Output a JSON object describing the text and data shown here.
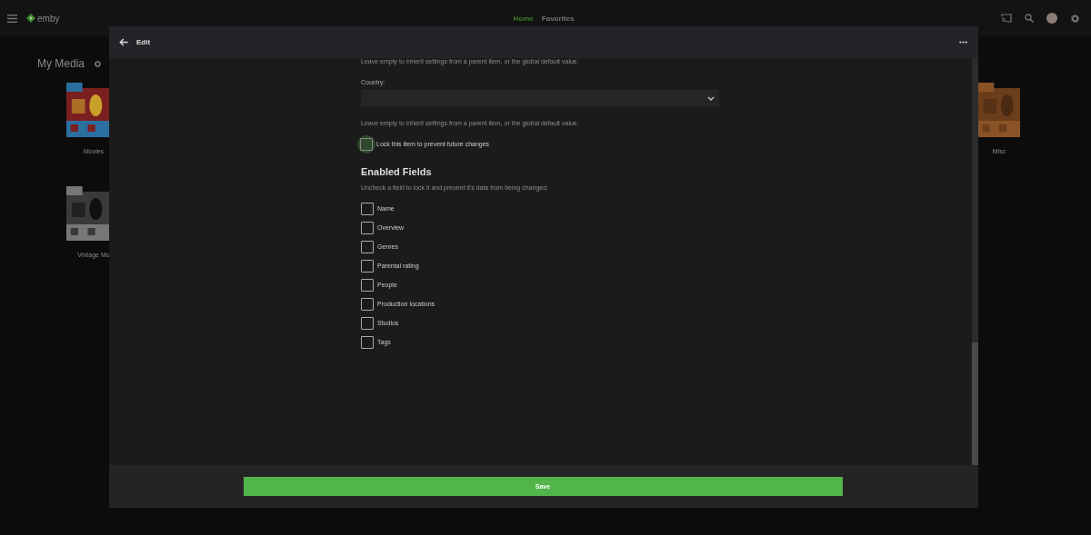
{
  "app_bar": {
    "logo": "emby",
    "tabs": [
      {
        "label": "Home",
        "selected": true
      },
      {
        "label": "Favorites",
        "selected": false
      }
    ]
  },
  "library": {
    "title": "My Media",
    "tile_rows": [
      {
        "tiles": [
          {
            "label": "Movies",
            "kind": "picture"
          },
          {
            "label": "Misc",
            "kind": "picture"
          }
        ]
      },
      {
        "tiles": [
          {
            "label": "Vintage Mo",
            "kind": "picture"
          }
        ]
      }
    ]
  },
  "dialog": {
    "title": "Edit",
    "content": [
      {
        "kind": "hint",
        "text": "Leave empty to inherit settings from a parent item, or the global default value."
      },
      {
        "kind": "select",
        "label": "Country:"
      },
      {
        "kind": "hint",
        "text": "Leave empty to inherit settings from a parent item, or the global default value."
      },
      {
        "kind": "checkbox",
        "label": "Lock this item to prevent future changes",
        "checked": false,
        "focused": true
      },
      {
        "kind": "heading",
        "text": "Enabled Fields"
      },
      {
        "kind": "hint",
        "text": "Uncheck a field to lock it and prevent it's data from being changed."
      },
      {
        "kind": "checkbox",
        "label": "Name",
        "checked": false,
        "focused": false
      },
      {
        "kind": "checkbox",
        "label": "Overview",
        "checked": false,
        "focused": false
      },
      {
        "kind": "checkbox",
        "label": "Genres",
        "checked": false,
        "focused": false
      },
      {
        "kind": "checkbox",
        "label": "Parental rating",
        "checked": false,
        "focused": false
      },
      {
        "kind": "checkbox",
        "label": "People",
        "checked": false,
        "focused": false
      },
      {
        "kind": "checkbox",
        "label": "Production locations",
        "checked": false,
        "focused": false
      },
      {
        "kind": "checkbox",
        "label": "Studios",
        "checked": false,
        "focused": false
      },
      {
        "kind": "checkbox",
        "label": "Tags",
        "checked": false,
        "focused": false
      }
    ],
    "save_button": "Save"
  }
}
